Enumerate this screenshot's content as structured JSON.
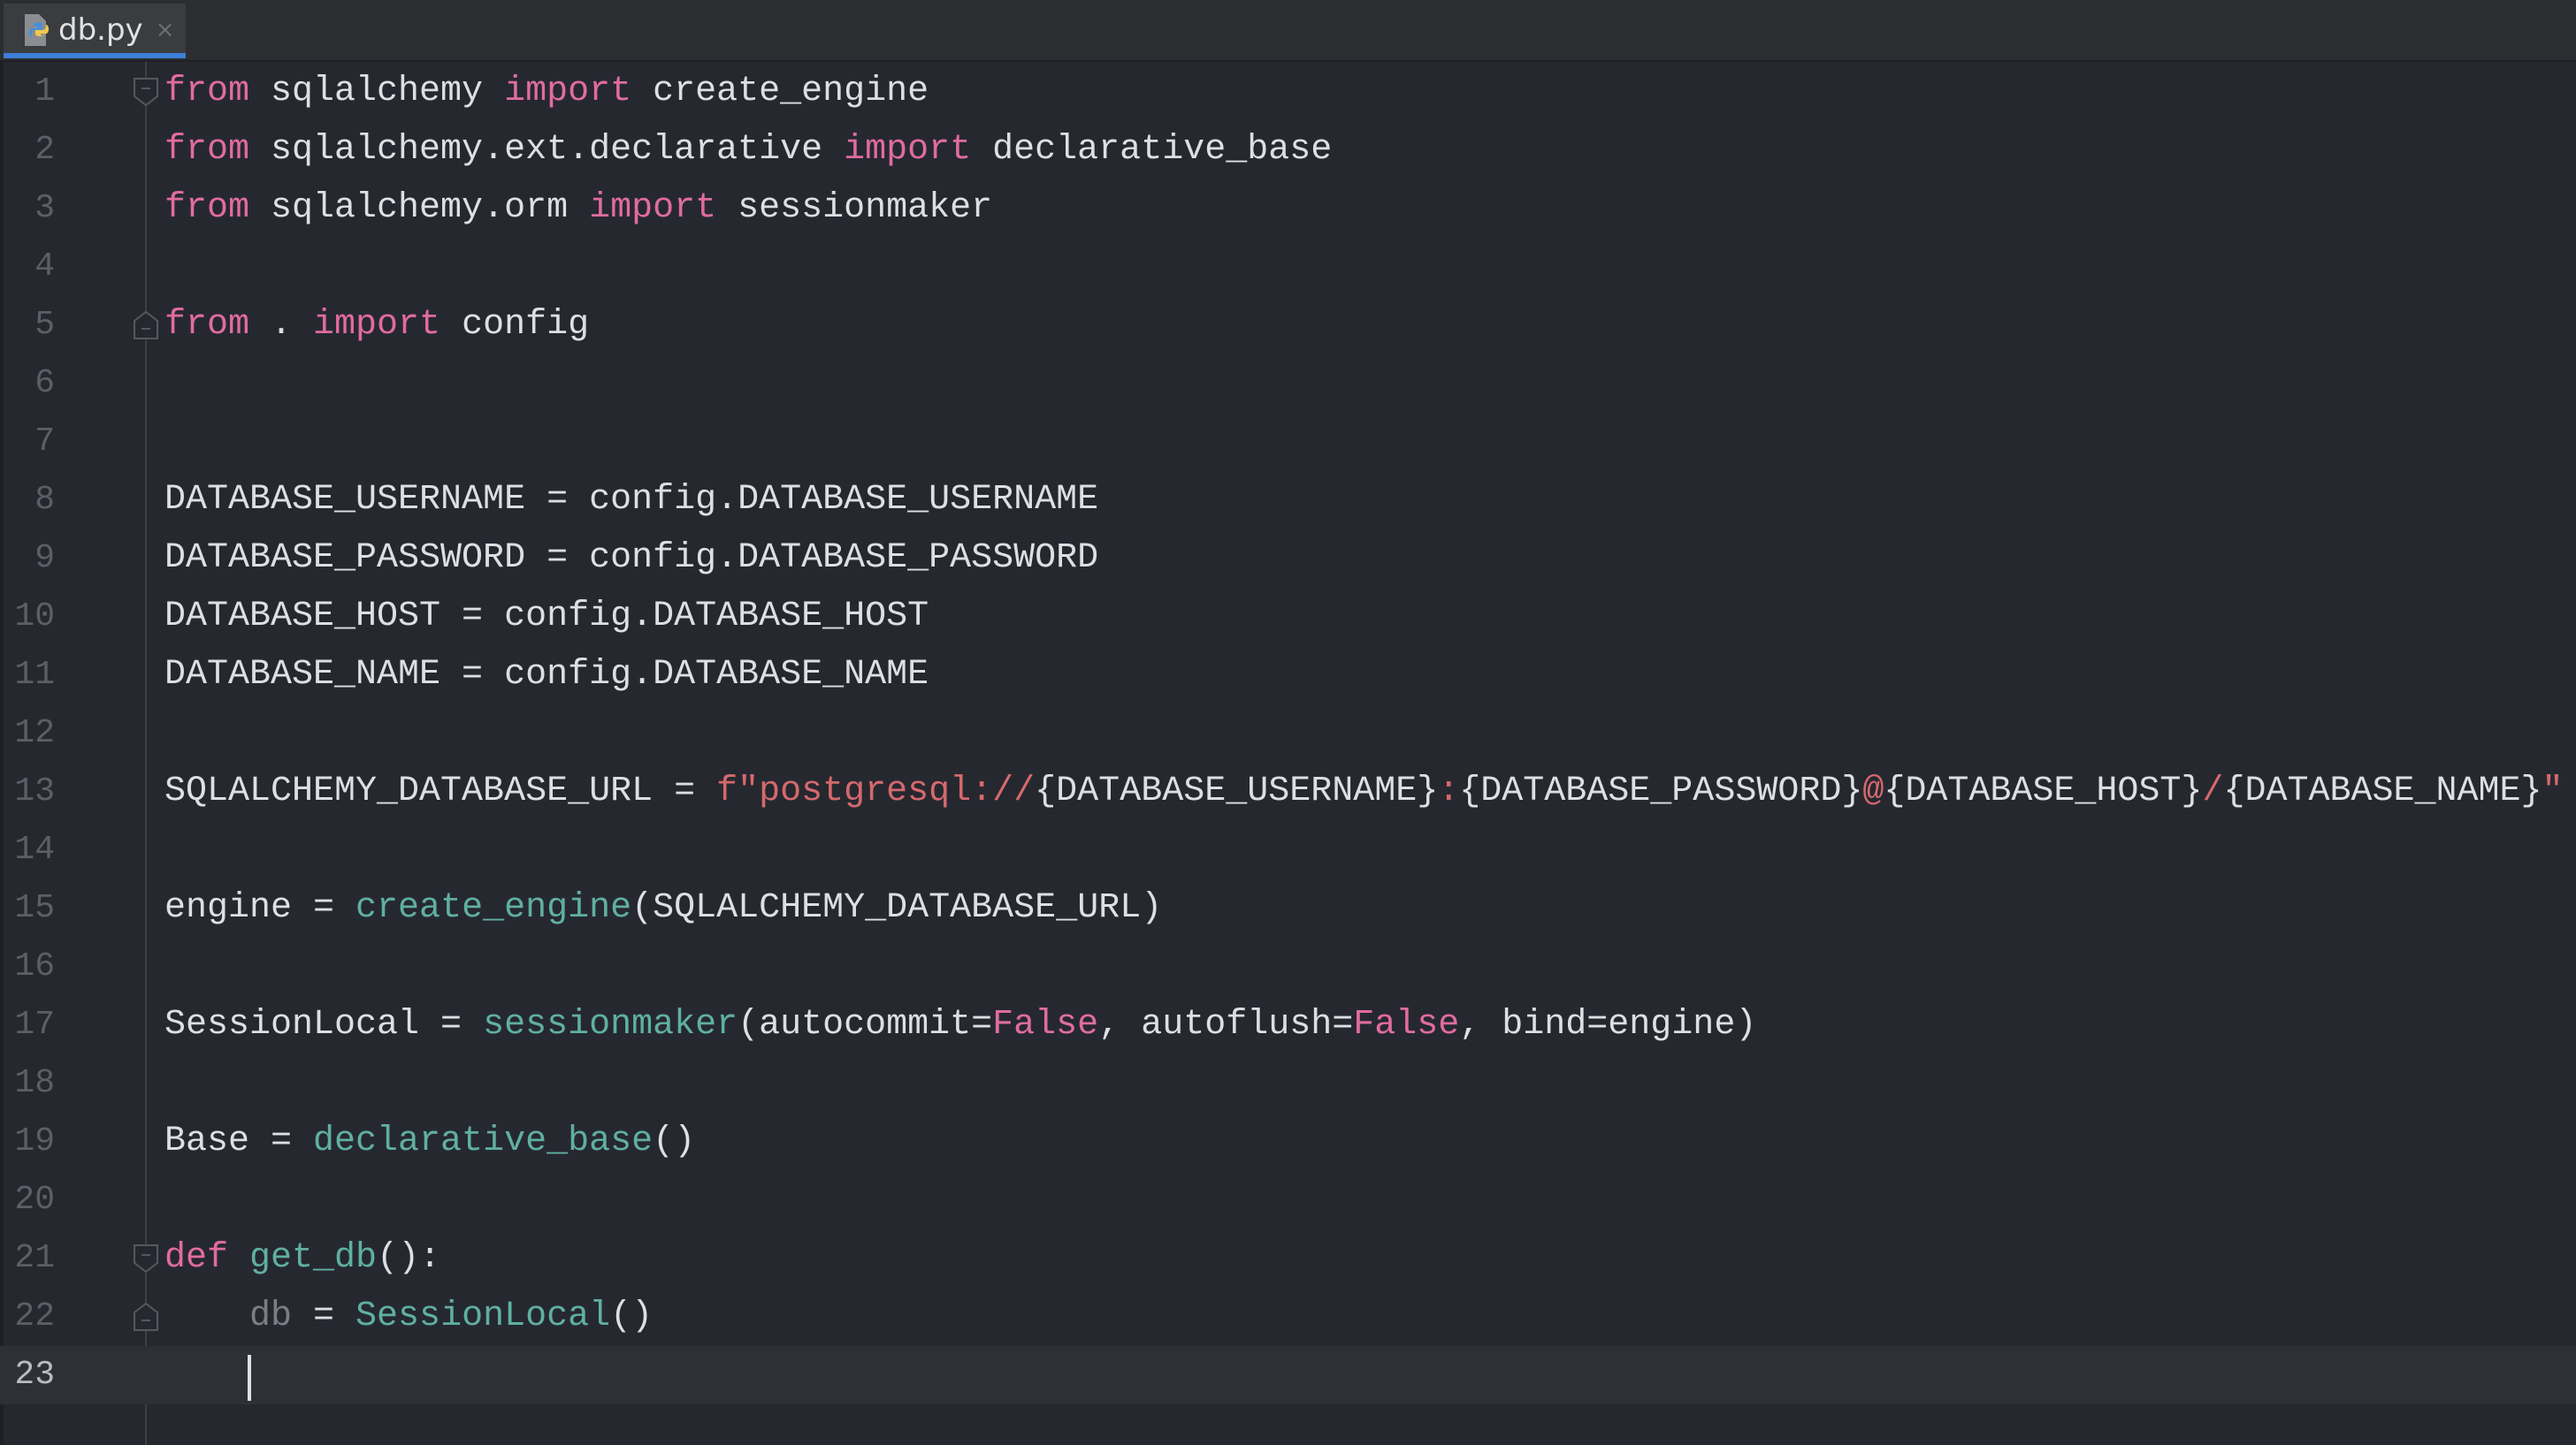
{
  "tab": {
    "filename": "db.py",
    "icon": "python-file-icon",
    "close_icon": "close-icon",
    "close_glyph": "×"
  },
  "colors": {
    "background": "#262830",
    "keyword": "#e06c9f",
    "function": "#5fb0a0",
    "string": "#d5696d",
    "text": "#dcdfe4",
    "accent": "#3d7fd6"
  },
  "current_line": 23,
  "lines": [
    {
      "n": "1",
      "fold": "start",
      "tokens": [
        [
          "kw",
          "from"
        ],
        [
          "plain",
          " sqlalchemy "
        ],
        [
          "kw",
          "import"
        ],
        [
          "plain",
          " create_engine"
        ]
      ]
    },
    {
      "n": "2",
      "tokens": [
        [
          "kw",
          "from"
        ],
        [
          "plain",
          " sqlalchemy.ext.declarative "
        ],
        [
          "kw",
          "import"
        ],
        [
          "plain",
          " declarative_base"
        ]
      ]
    },
    {
      "n": "3",
      "tokens": [
        [
          "kw",
          "from"
        ],
        [
          "plain",
          " sqlalchemy.orm "
        ],
        [
          "kw",
          "import"
        ],
        [
          "plain",
          " sessionmaker"
        ]
      ]
    },
    {
      "n": "4",
      "tokens": []
    },
    {
      "n": "5",
      "fold": "end",
      "tokens": [
        [
          "kw",
          "from"
        ],
        [
          "plain",
          " . "
        ],
        [
          "kw",
          "import"
        ],
        [
          "plain",
          " config"
        ]
      ]
    },
    {
      "n": "6",
      "tokens": []
    },
    {
      "n": "7",
      "tokens": []
    },
    {
      "n": "8",
      "tokens": [
        [
          "plain",
          "DATABASE_USERNAME = config.DATABASE_USERNAME"
        ]
      ]
    },
    {
      "n": "9",
      "tokens": [
        [
          "plain",
          "DATABASE_PASSWORD = config.DATABASE_PASSWORD"
        ]
      ]
    },
    {
      "n": "10",
      "tokens": [
        [
          "plain",
          "DATABASE_HOST = config.DATABASE_HOST"
        ]
      ]
    },
    {
      "n": "11",
      "tokens": [
        [
          "plain",
          "DATABASE_NAME = config.DATABASE_NAME"
        ]
      ]
    },
    {
      "n": "12",
      "tokens": []
    },
    {
      "n": "13",
      "tokens": [
        [
          "plain",
          "SQLALCHEMY_DATABASE_URL = "
        ],
        [
          "str",
          "f\"postgresql://"
        ],
        [
          "plain",
          "{DATABASE_USERNAME}"
        ],
        [
          "str",
          ":"
        ],
        [
          "plain",
          "{DATABASE_PASSWORD}"
        ],
        [
          "str",
          "@"
        ],
        [
          "plain",
          "{DATABASE_HOST}"
        ],
        [
          "str",
          "/"
        ],
        [
          "plain",
          "{DATABASE_NAME}"
        ],
        [
          "str",
          "\""
        ]
      ]
    },
    {
      "n": "14",
      "tokens": []
    },
    {
      "n": "15",
      "tokens": [
        [
          "plain",
          "engine = "
        ],
        [
          "fn",
          "create_engine"
        ],
        [
          "plain",
          "(SQLALCHEMY_DATABASE_URL)"
        ]
      ]
    },
    {
      "n": "16",
      "tokens": []
    },
    {
      "n": "17",
      "tokens": [
        [
          "plain",
          "SessionLocal = "
        ],
        [
          "fn",
          "sessionmaker"
        ],
        [
          "plain",
          "(autocommit="
        ],
        [
          "kw",
          "False"
        ],
        [
          "plain",
          ", autoflush="
        ],
        [
          "kw",
          "False"
        ],
        [
          "plain",
          ", bind=engine)"
        ]
      ]
    },
    {
      "n": "18",
      "tokens": []
    },
    {
      "n": "19",
      "tokens": [
        [
          "plain",
          "Base = "
        ],
        [
          "fn",
          "declarative_base"
        ],
        [
          "plain",
          "()"
        ]
      ]
    },
    {
      "n": "20",
      "tokens": []
    },
    {
      "n": "21",
      "fold": "start",
      "tokens": [
        [
          "kw",
          "def"
        ],
        [
          "plain",
          " "
        ],
        [
          "fn",
          "get_db"
        ],
        [
          "plain",
          "():"
        ]
      ]
    },
    {
      "n": "22",
      "fold": "end",
      "tokens": [
        [
          "plain",
          "    "
        ],
        [
          "unused",
          "db"
        ],
        [
          "plain",
          " = "
        ],
        [
          "fn",
          "SessionLocal"
        ],
        [
          "plain",
          "()"
        ]
      ]
    },
    {
      "n": "23",
      "tokens": []
    }
  ]
}
